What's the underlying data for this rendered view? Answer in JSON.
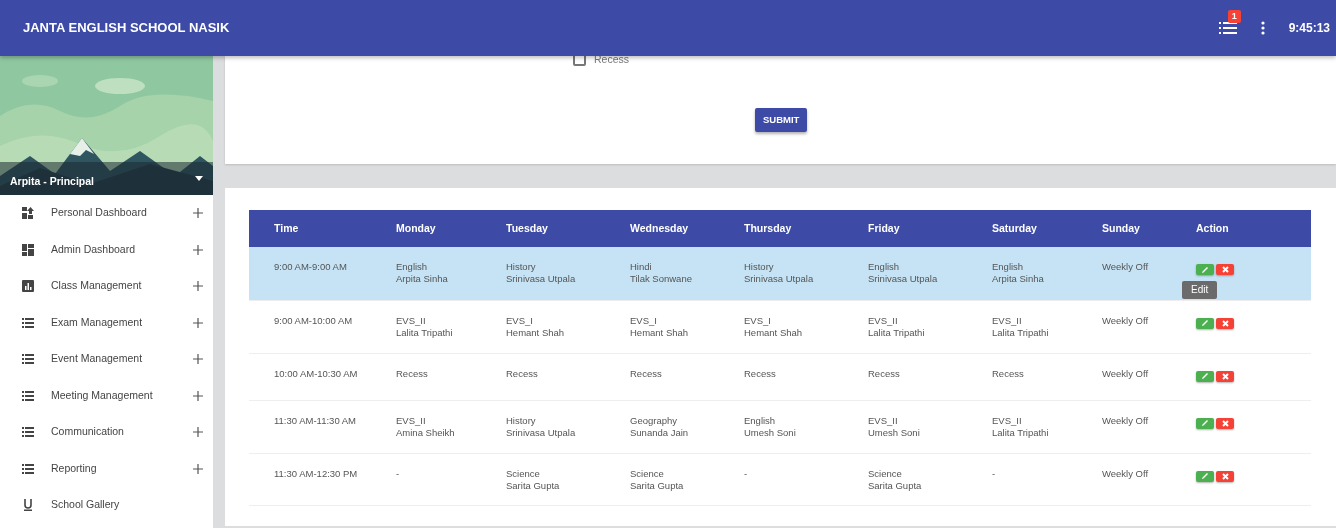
{
  "app_bar": {
    "title": "JANTA ENGLISH SCHOOL NASIK",
    "notification_count": "1",
    "clock": "9:45:13"
  },
  "sidebar": {
    "profile": {
      "kind": "picture",
      "user": "Arpita - Principal"
    },
    "items": [
      {
        "label": "Personal Dashboard",
        "kind": "dashboard-up",
        "expandable": true
      },
      {
        "label": "Admin Dashboard",
        "kind": "dashboard",
        "expandable": true
      },
      {
        "label": "Class Management",
        "kind": "chart",
        "expandable": true
      },
      {
        "label": "Exam Management",
        "kind": "list",
        "expandable": true
      },
      {
        "label": "Event Management",
        "kind": "list",
        "expandable": true
      },
      {
        "label": "Meeting Management",
        "kind": "list",
        "expandable": true
      },
      {
        "label": "Communication",
        "kind": "list",
        "expandable": true
      },
      {
        "label": "Reporting",
        "kind": "list",
        "expandable": true
      },
      {
        "label": "School Gallery",
        "kind": "underline",
        "expandable": false
      }
    ]
  },
  "form": {
    "recess_checkbox": {
      "label": "Recess",
      "checked": false
    },
    "submit": "SUBMIT"
  },
  "table": {
    "columns": [
      "Time",
      "Monday",
      "Tuesday",
      "Wednesday",
      "Thursday",
      "Friday",
      "Saturday",
      "Sunday",
      "Action"
    ],
    "rows": [
      {
        "selected": true,
        "tooltip": "Edit",
        "cells": [
          {
            "lines": [
              "9:00 AM-9:00 AM"
            ]
          },
          {
            "lines": [
              "English",
              "Arpita Sinha"
            ]
          },
          {
            "lines": [
              "History",
              "Srinivasa Utpala"
            ]
          },
          {
            "lines": [
              "Hindi",
              "Tilak Sonwane"
            ]
          },
          {
            "lines": [
              "History",
              "Srinivasa Utpala"
            ]
          },
          {
            "lines": [
              "English",
              "Srinivasa Utpala"
            ]
          },
          {
            "lines": [
              "English",
              "Arpita Sinha"
            ]
          },
          {
            "lines": [
              "Weekly Off"
            ]
          }
        ]
      },
      {
        "selected": false,
        "cells": [
          {
            "lines": [
              "9:00 AM-10:00 AM"
            ]
          },
          {
            "lines": [
              "EVS_II",
              "Lalita Tripathi"
            ]
          },
          {
            "lines": [
              "EVS_I",
              "Hemant Shah"
            ]
          },
          {
            "lines": [
              "EVS_I",
              "Hemant Shah"
            ]
          },
          {
            "lines": [
              "EVS_I",
              "Hemant Shah"
            ]
          },
          {
            "lines": [
              "EVS_II",
              "Lalita Tripathi"
            ]
          },
          {
            "lines": [
              "EVS_II",
              "Lalita Tripathi"
            ]
          },
          {
            "lines": [
              "Weekly Off"
            ]
          }
        ]
      },
      {
        "selected": false,
        "cells": [
          {
            "lines": [
              "10:00 AM-10:30 AM"
            ]
          },
          {
            "lines": [
              "Recess"
            ]
          },
          {
            "lines": [
              "Recess"
            ]
          },
          {
            "lines": [
              "Recess"
            ]
          },
          {
            "lines": [
              "Recess"
            ]
          },
          {
            "lines": [
              "Recess"
            ]
          },
          {
            "lines": [
              "Recess"
            ]
          },
          {
            "lines": [
              "Weekly Off"
            ]
          }
        ]
      },
      {
        "selected": false,
        "cells": [
          {
            "lines": [
              "11:30 AM-11:30 AM"
            ]
          },
          {
            "lines": [
              "EVS_II",
              "Amina Sheikh"
            ]
          },
          {
            "lines": [
              "History",
              "Srinivasa Utpala"
            ]
          },
          {
            "lines": [
              "Geography",
              "Sunanda Jain"
            ]
          },
          {
            "lines": [
              "English",
              "Umesh Soni"
            ]
          },
          {
            "lines": [
              "EVS_II",
              "Umesh Soni"
            ]
          },
          {
            "lines": [
              "EVS_II",
              "Lalita Tripathi"
            ]
          },
          {
            "lines": [
              "Weekly Off"
            ]
          }
        ]
      },
      {
        "selected": false,
        "cells": [
          {
            "lines": [
              "11:30 AM-12:30 PM"
            ]
          },
          {
            "lines": [
              "-"
            ]
          },
          {
            "lines": [
              "Science",
              "Sarita Gupta"
            ]
          },
          {
            "lines": [
              "Science",
              "Sarita Gupta"
            ]
          },
          {
            "lines": [
              "-"
            ]
          },
          {
            "lines": [
              "Science",
              "Sarita Gupta"
            ]
          },
          {
            "lines": [
              "-"
            ]
          },
          {
            "lines": [
              "Weekly Off"
            ]
          }
        ]
      }
    ]
  }
}
